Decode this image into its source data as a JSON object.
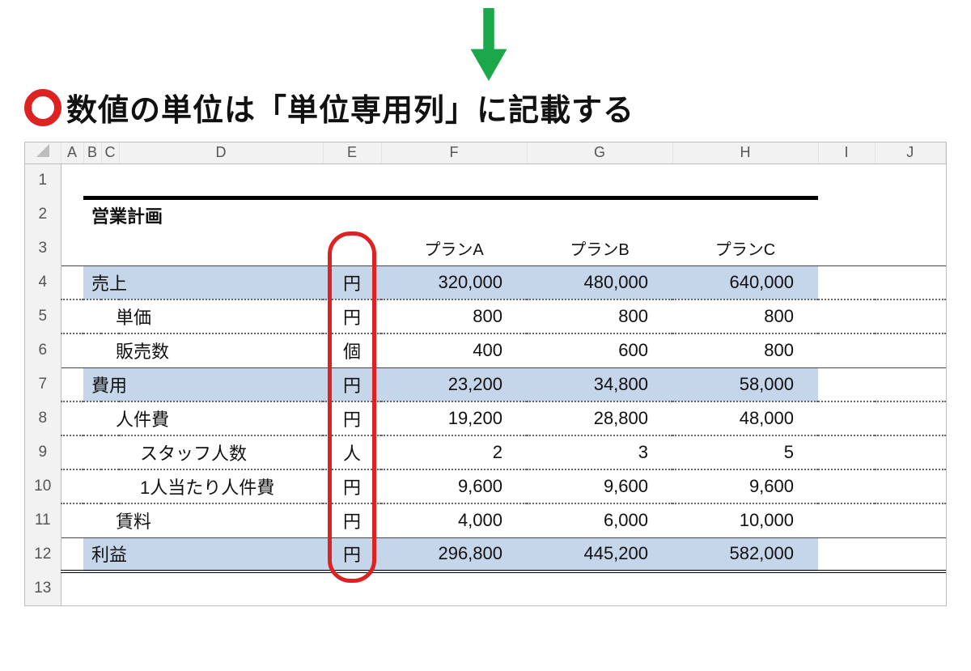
{
  "arrow_color": "#1aa84b",
  "heading": "数値の単位は「単位専用列」に記載する",
  "columns": [
    "A",
    "B",
    "C",
    "D",
    "E",
    "F",
    "G",
    "H",
    "I",
    "J"
  ],
  "row_numbers": [
    "1",
    "2",
    "3",
    "4",
    "5",
    "6",
    "7",
    "8",
    "9",
    "10",
    "11",
    "12",
    "13"
  ],
  "title": "営業計画",
  "plan_headers": [
    "プランA",
    "プランB",
    "プランC"
  ],
  "rows": [
    {
      "label": "売上",
      "indent": 0,
      "unit": "円",
      "vals": [
        "320,000",
        "480,000",
        "640,000"
      ],
      "hl": true
    },
    {
      "label": "単価",
      "indent": 1,
      "unit": "円",
      "vals": [
        "800",
        "800",
        "800"
      ],
      "hl": false
    },
    {
      "label": "販売数",
      "indent": 1,
      "unit": "個",
      "vals": [
        "400",
        "600",
        "800"
      ],
      "hl": false
    },
    {
      "label": "費用",
      "indent": 0,
      "unit": "円",
      "vals": [
        "23,200",
        "34,800",
        "58,000"
      ],
      "hl": true
    },
    {
      "label": "人件費",
      "indent": 1,
      "unit": "円",
      "vals": [
        "19,200",
        "28,800",
        "48,000"
      ],
      "hl": false
    },
    {
      "label": "スタッフ人数",
      "indent": 2,
      "unit": "人",
      "vals": [
        "2",
        "3",
        "5"
      ],
      "hl": false
    },
    {
      "label": "1人当たり人件費",
      "indent": 2,
      "unit": "円",
      "vals": [
        "9,600",
        "9,600",
        "9,600"
      ],
      "hl": false
    },
    {
      "label": "賃料",
      "indent": 1,
      "unit": "円",
      "vals": [
        "4,000",
        "6,000",
        "10,000"
      ],
      "hl": false
    },
    {
      "label": "利益",
      "indent": 0,
      "unit": "円",
      "vals": [
        "296,800",
        "445,200",
        "582,000"
      ],
      "hl": true
    }
  ]
}
